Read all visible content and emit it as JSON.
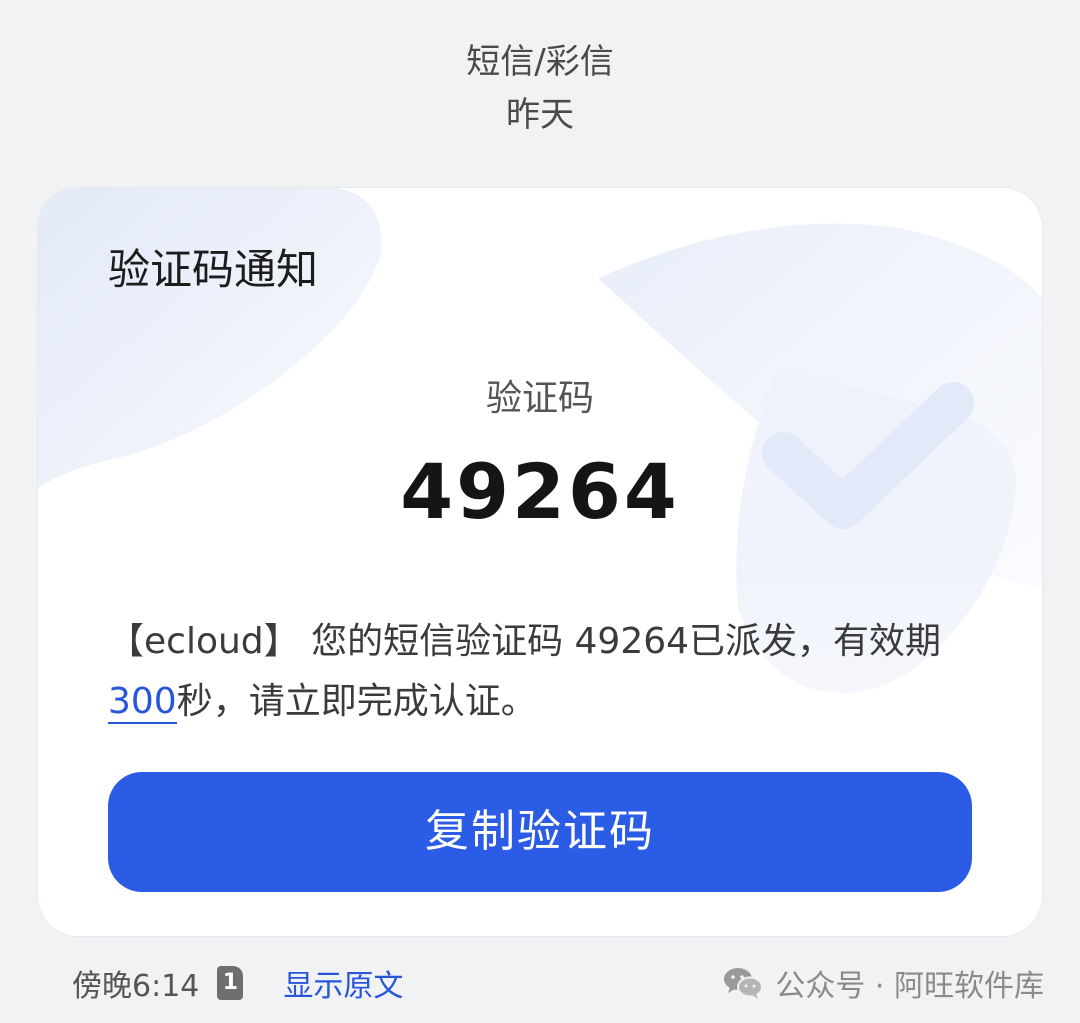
{
  "header": {
    "message_type": "短信/彩信",
    "date": "昨天"
  },
  "card": {
    "title": "验证码通知",
    "code_label": "验证码",
    "code": "49264",
    "message_before": "【ecloud】 您的短信验证码 49264已派发，有效期",
    "message_link": "300",
    "message_after": "秒，请立即完成认证。",
    "copy_button_label": "复制验证码"
  },
  "footer": {
    "time": "傍晚6:14",
    "sim_slot": "1",
    "show_original_label": "显示原文"
  },
  "watermark": {
    "icon": "wechat-icon",
    "text": "公众号 · 阿旺软件库"
  },
  "colors": {
    "background": "#f1f2f4",
    "card": "#ffffff",
    "accent": "#2b5ce6",
    "link": "#2856d8"
  }
}
